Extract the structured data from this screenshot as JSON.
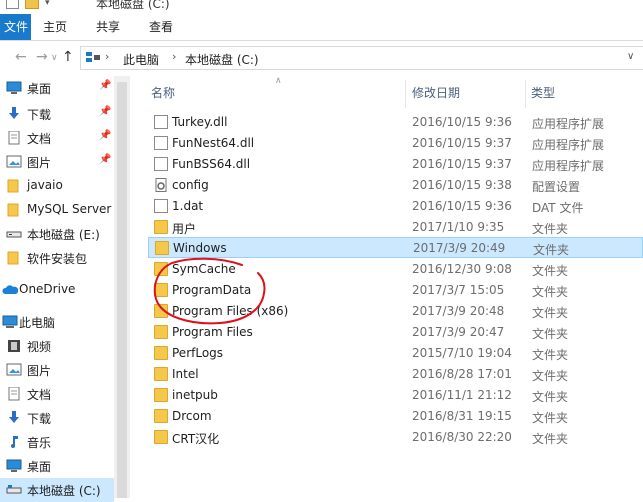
{
  "titlebar": {
    "title": "本地磁盘 (C:)"
  },
  "ribbon": {
    "tabs": [
      {
        "id": "file",
        "label": "文件"
      },
      {
        "id": "home",
        "label": "主页"
      },
      {
        "id": "share",
        "label": "共享"
      },
      {
        "id": "view",
        "label": "查看"
      }
    ]
  },
  "address": {
    "crumbs": [
      "此电脑",
      "本地磁盘 (C:)"
    ]
  },
  "nav": {
    "items": [
      {
        "label": "桌面",
        "icon": "desktop-icon",
        "pinned": true
      },
      {
        "label": "下载",
        "icon": "download-icon",
        "pinned": true
      },
      {
        "label": "文档",
        "icon": "document-icon",
        "pinned": true
      },
      {
        "label": "图片",
        "icon": "picture-icon",
        "pinned": true
      },
      {
        "label": "javaio",
        "icon": "folder-icon"
      },
      {
        "label": "MySQL Server",
        "icon": "folder-icon"
      },
      {
        "label": "本地磁盘 (E:)",
        "icon": "drive-icon"
      },
      {
        "label": "软件安装包",
        "icon": "folder-icon"
      },
      {
        "label": "OneDrive",
        "icon": "cloud-icon"
      },
      {
        "label": "此电脑",
        "icon": "computer-icon"
      },
      {
        "label": "视频",
        "icon": "video-icon"
      },
      {
        "label": "图片",
        "icon": "picture-icon"
      },
      {
        "label": "文档",
        "icon": "document-icon"
      },
      {
        "label": "下载",
        "icon": "download-icon"
      },
      {
        "label": "音乐",
        "icon": "music-icon"
      },
      {
        "label": "桌面",
        "icon": "desktop-icon"
      },
      {
        "label": "本地磁盘 (C:)",
        "icon": "drive-icon",
        "selected": true
      }
    ]
  },
  "columns": {
    "name": "名称",
    "modified": "修改日期",
    "type": "类型"
  },
  "files": [
    {
      "name": "Turkey.dll",
      "date": "2016/10/15 9:36",
      "type": "应用程序扩展",
      "kind": "file"
    },
    {
      "name": "FunNest64.dll",
      "date": "2016/10/15 9:37",
      "type": "应用程序扩展",
      "kind": "file"
    },
    {
      "name": "FunBSS64.dll",
      "date": "2016/10/15 9:37",
      "type": "应用程序扩展",
      "kind": "file"
    },
    {
      "name": "config",
      "date": "2016/10/15 9:38",
      "type": "配置设置",
      "kind": "config"
    },
    {
      "name": "1.dat",
      "date": "2016/10/15 9:36",
      "type": "DAT 文件",
      "kind": "file"
    },
    {
      "name": "用户",
      "date": "2017/1/10 9:35",
      "type": "文件夹",
      "kind": "folder"
    },
    {
      "name": "Windows",
      "date": "2017/3/9 20:49",
      "type": "文件夹",
      "kind": "folder",
      "selected": true
    },
    {
      "name": "SymCache",
      "date": "2016/12/30 9:08",
      "type": "文件夹",
      "kind": "folder"
    },
    {
      "name": "ProgramData",
      "date": "2017/3/7 15:05",
      "type": "文件夹",
      "kind": "folder"
    },
    {
      "name": "Program Files (x86)",
      "date": "2017/3/9 20:48",
      "type": "文件夹",
      "kind": "folder"
    },
    {
      "name": "Program Files",
      "date": "2017/3/9 20:47",
      "type": "文件夹",
      "kind": "folder"
    },
    {
      "name": "PerfLogs",
      "date": "2015/7/10 19:04",
      "type": "文件夹",
      "kind": "folder"
    },
    {
      "name": "Intel",
      "date": "2016/8/28 17:01",
      "type": "文件夹",
      "kind": "folder"
    },
    {
      "name": "inetpub",
      "date": "2016/11/1 21:12",
      "type": "文件夹",
      "kind": "folder"
    },
    {
      "name": "Drcom",
      "date": "2016/8/31 19:15",
      "type": "文件夹",
      "kind": "folder"
    },
    {
      "name": "CRT汉化",
      "date": "2016/8/30 22:20",
      "type": "文件夹",
      "kind": "folder"
    }
  ],
  "colors": {
    "selection": "#cce8ff",
    "file_tab": "#1979ca",
    "annotation": "#e0101a"
  }
}
